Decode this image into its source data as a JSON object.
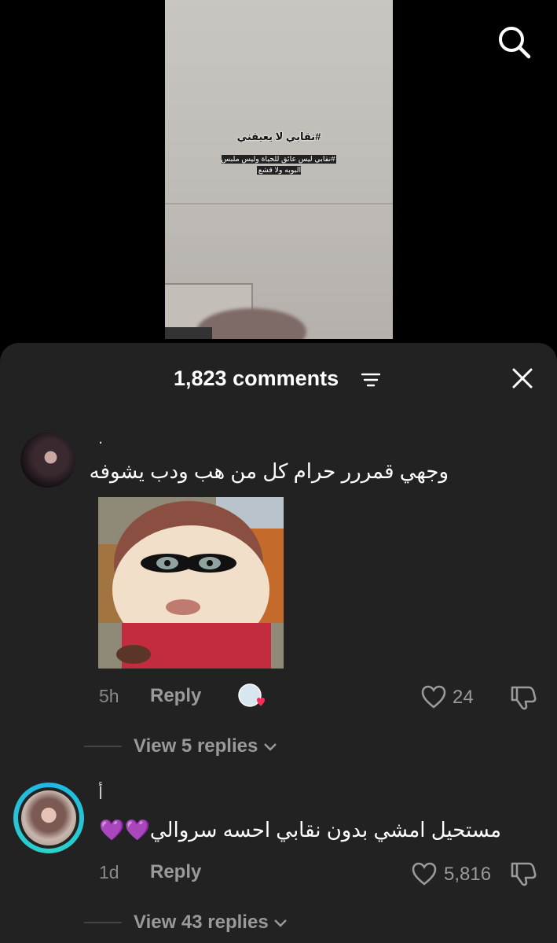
{
  "video": {
    "caption_main": "#نقابي لا يعيقني",
    "caption_sub": "#نقابي ليس عائق للحياة وليس ملبس البوبه ولا قشع"
  },
  "sheet": {
    "title": "1,823 comments"
  },
  "comments": [
    {
      "username": ".",
      "text": "وجهي قمررر حرام كل من هب ودب يشوفه",
      "time": "5h",
      "reply_label": "Reply",
      "likes": "24",
      "view_replies": "View 5 replies"
    },
    {
      "username": "أ",
      "text": "مستحيل امشي بدون نقابي احسه سروالي💜💜",
      "time": "1d",
      "reply_label": "Reply",
      "likes": "5,816",
      "view_replies": "View 43 replies"
    }
  ],
  "icons": {
    "search": "search-icon",
    "filter": "filter-icon",
    "close": "close-icon",
    "like": "heart-icon",
    "dislike": "dislike-icon",
    "chevron": "chevron-down-icon"
  },
  "colors": {
    "sheet_bg": "#222222",
    "avatar_ring": "#1fb6e6",
    "secondary_text": "#9a9a9a"
  }
}
